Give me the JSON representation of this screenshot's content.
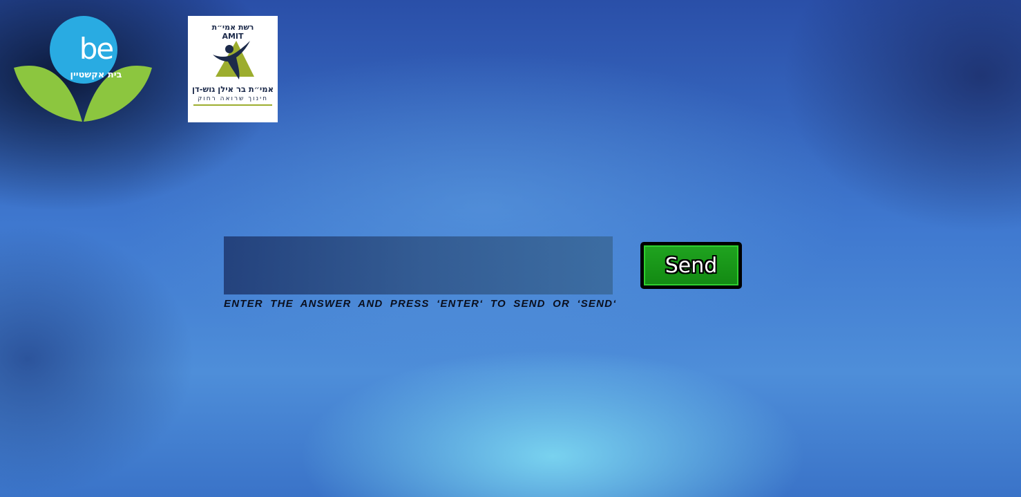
{
  "logos": {
    "be": {
      "mark": "be",
      "subtitle": "בית אקשטיין",
      "colors": {
        "circle": "#29abe2",
        "leaves": "#8cc63f"
      }
    },
    "amit": {
      "arc_text": "רשת אמי״ת AMIT",
      "name": "אמי״ת בר אילן גוש-דן",
      "tagline": "חינוך שרואה רחוק",
      "colors": {
        "navy": "#1c2a4a",
        "olive": "#9cad2e"
      }
    }
  },
  "answer": {
    "value": "",
    "placeholder": "",
    "hint": "Enter the answer and press ‘enter‘ to send or ‘send‘"
  },
  "send_button": {
    "label": "Send",
    "colors": {
      "fill": "#138a13",
      "border": "#2fd02f",
      "frame": "#000000"
    }
  }
}
